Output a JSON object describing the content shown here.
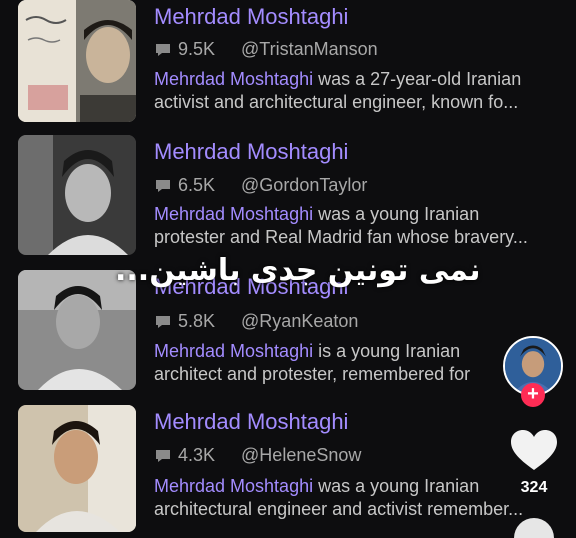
{
  "results": [
    {
      "title": "Mehrdad Moshtaghi",
      "count": "9.5K",
      "handle": "@TristanManson",
      "desc_highlight": "Mehrdad Moshtaghi",
      "desc_line1_rest": " was a 27-year-old Iranian",
      "desc_line2": "activist and architectural engineer, known fo..."
    },
    {
      "title": "Mehrdad Moshtaghi",
      "count": "6.5K",
      "handle": "@GordonTaylor",
      "desc_highlight": "Mehrdad Moshtaghi",
      "desc_line1_rest": " was a young Iranian",
      "desc_line2": "protester and Real Madrid fan whose bravery..."
    },
    {
      "title": "Mehrdad Moshtaghi",
      "count": "5.8K",
      "handle": "@RyanKeaton",
      "desc_highlight": "Mehrdad Moshtaghi",
      "desc_line1_rest": " is a young Iranian",
      "desc_line2": "architect and protester, remembered for"
    },
    {
      "title": "Mehrdad Moshtaghi",
      "count": "4.3K",
      "handle": "@HeleneSnow",
      "desc_highlight": "Mehrdad Moshtaghi",
      "desc_line1_rest": " was a young Iranian",
      "desc_line2": "architectural engineer and activist remember..."
    }
  ],
  "overlay_text": "نمی تونین جدی باشین...",
  "sidebar": {
    "follow_label": "+",
    "like_count": "324"
  },
  "colors": {
    "background": "#0d0d0f",
    "title": "#a38cff",
    "like_accent": "#fe2c55"
  }
}
